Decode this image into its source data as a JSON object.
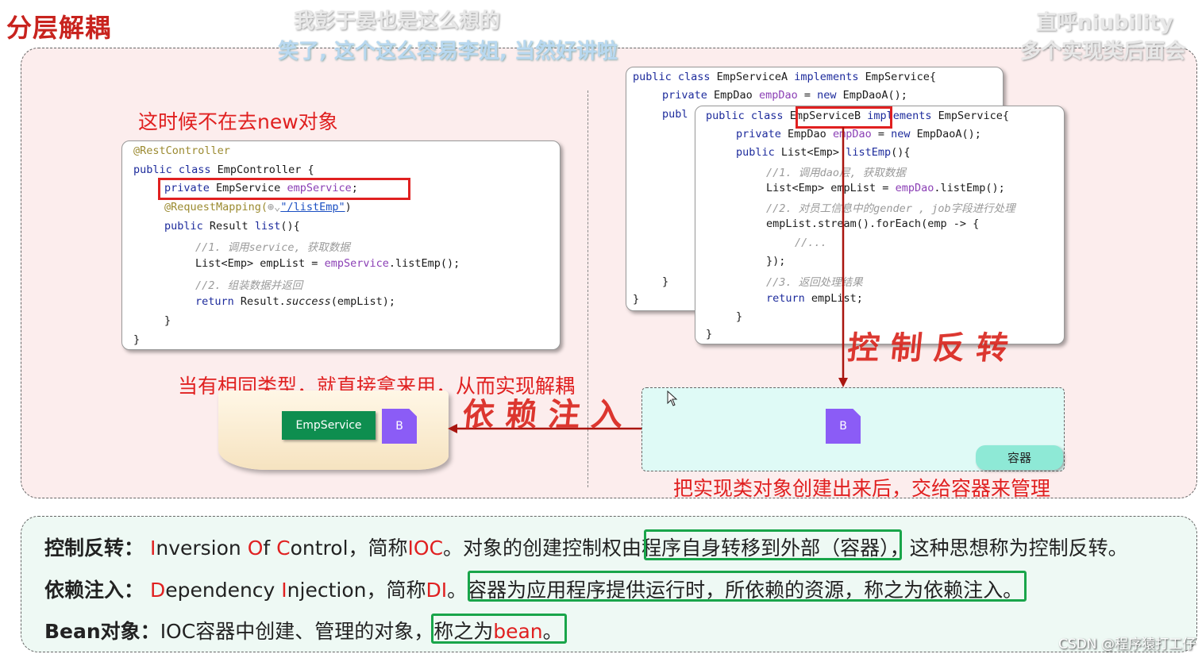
{
  "slide": {
    "title": "分层解耦"
  },
  "danmaku": [
    "我彭于晏也是这么想的",
    "笑了, 这个这么容易李姐, 当然好讲啦",
    "直呼niubility",
    "多个实现类后面会"
  ],
  "left": {
    "note_top": "这时候不在去new对象",
    "note_bottom": "当有相同类型，就直接拿来用，从而实现解耦",
    "controller_code": {
      "l1": "@RestController",
      "l2_kw": "public class",
      "l2_name": " EmpController {",
      "l3_kw": "private",
      "l3_type": " EmpService ",
      "l3_field": "empService",
      "l3_end": ";",
      "l4_ann": "@RequestMapping(",
      "l4_str": "\"/listEmp\"",
      "l4_end": ")",
      "l5_kw": "public",
      "l5_rest": " Result ",
      "l5_m": "list",
      "l5_end": "(){",
      "l6": "//1. 调用service, 获取数据",
      "l7_a": "List<Emp> empList = ",
      "l7_f": "empService",
      "l7_b": ".listEmp();",
      "l8": "//2. 组装数据并返回",
      "l9_kw": "return",
      "l9_a": " Result.",
      "l9_it": "success",
      "l9_b": "(empList);",
      "l10": "}",
      "l11": "}"
    },
    "flag_label": "EmpService",
    "bean_label": "B"
  },
  "right": {
    "code_a": {
      "l1_kw": "public class",
      "l1_name": " EmpServiceA ",
      "l1_kw2": "implements",
      "l1_end": " EmpService{",
      "l2_kw": "private",
      "l2_type": " EmpDao ",
      "l2_field": "empDao",
      "l2_eq": " = ",
      "l2_kw2": "new",
      "l2_end": " EmpDaoA();",
      "l3": "publ",
      "l4": "}",
      "l5": "}"
    },
    "code_b": {
      "l1_kw": "public class",
      "l1_name": "EmpServiceB",
      "l1_kw2": "implements",
      "l1_end": " EmpService{",
      "l2_kw": "private",
      "l2_type": " EmpDao ",
      "l2_field": "empDao",
      "l2_eq": " = ",
      "l2_kw2": "new",
      "l2_end": " EmpDaoA();",
      "l3_kw": "public",
      "l3_a": " List<Emp> ",
      "l3_m": "listEmp",
      "l3_end": "(){",
      "l4": "//1. 调用dao层, 获取数据",
      "l5_a": "List<Emp> empList = ",
      "l5_f": "empDao",
      "l5_b": ".listEmp();",
      "l6": "//2. 对员工信息中的gender , job字段进行处理",
      "l7": "empList.stream().forEach(emp -> {",
      "l8": "//...",
      "l9": "});",
      "l10": "//3. 返回处理结果",
      "l11_kw": "return",
      "l11_a": " empList;",
      "l12": "}",
      "l13": "}"
    },
    "hand_ioc": "控制反转",
    "hand_di": "依赖注入",
    "bean_label": "B",
    "container_label": "容器",
    "note_bottom": "把实现类对象创建出来后，交给容器来管理"
  },
  "definitions": {
    "ioc_term": "控制反转：",
    "ioc_i": "I",
    "ioc_nversion": "nversion ",
    "ioc_o": "O",
    "ioc_f": "f ",
    "ioc_c": "C",
    "ioc_ontrol": "ontrol，简称",
    "ioc_abbr": "IOC",
    "ioc_mid": "。对象的创建控制权由",
    "ioc_hl": "程序自身转移到外部（容器）",
    "ioc_end": "，这种思想称为控制反转。",
    "di_term": "依赖注入：",
    "di_d": "D",
    "di_ependency": "ependency ",
    "di_i": "I",
    "di_njection": "njection，简称",
    "di_abbr": "DI",
    "di_mid": "。",
    "di_hl": "容器为应用程序提供运行时，所依赖的资源，称之为依赖注入。",
    "bean_term": "Bean对象：",
    "bean_mid": "IOC容器中创建、管理的对象，",
    "bean_hl_a": "称之为",
    "bean_hl_red": "bean",
    "bean_hl_b": "。"
  },
  "watermark": "CSDN @程序猿打工仔",
  "colors": {
    "accent_red": "#e02020",
    "highlight_green": "#19a54a",
    "panel_pink": "#fceded",
    "panel_mint": "#eef9f4",
    "container_cyan": "#dffaf6",
    "bean_purple": "#8b5cf6",
    "flag_green": "#0e8e4f"
  }
}
